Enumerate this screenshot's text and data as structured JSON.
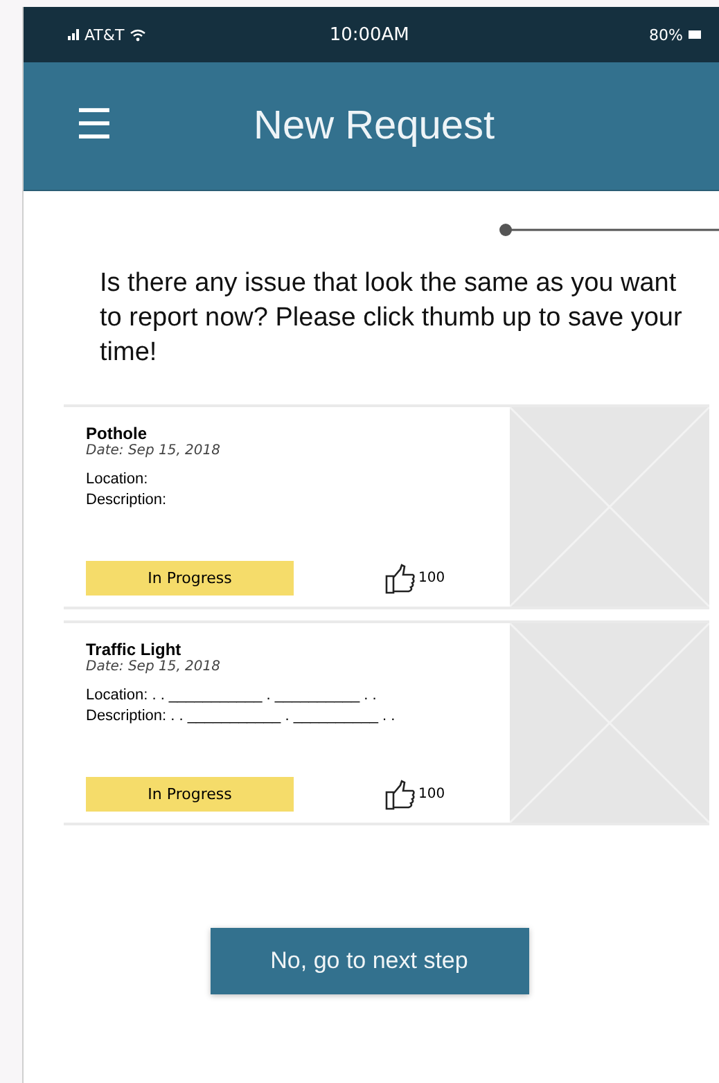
{
  "status_bar": {
    "carrier": "AT&T",
    "time": "10:00AM",
    "battery": "80%"
  },
  "header": {
    "menu": "☰",
    "title": "New Request"
  },
  "question": "Is there any issue that look the same as you want to report now? Please click thumb up to save your time!",
  "requests": [
    {
      "title": "Pothole",
      "date": "Date: Sep 15, 2018",
      "location": "Location:",
      "description": "Description:",
      "status": "In Progress",
      "likes": "100"
    },
    {
      "title": "Traffic Light",
      "date": "Date: Sep 15, 2018",
      "location": "Location: . . ___________ . __________ . .",
      "description": "Description: . . ___________ . __________ . .",
      "status": "In Progress",
      "likes": "100"
    }
  ],
  "next_button": "No, go to next step"
}
